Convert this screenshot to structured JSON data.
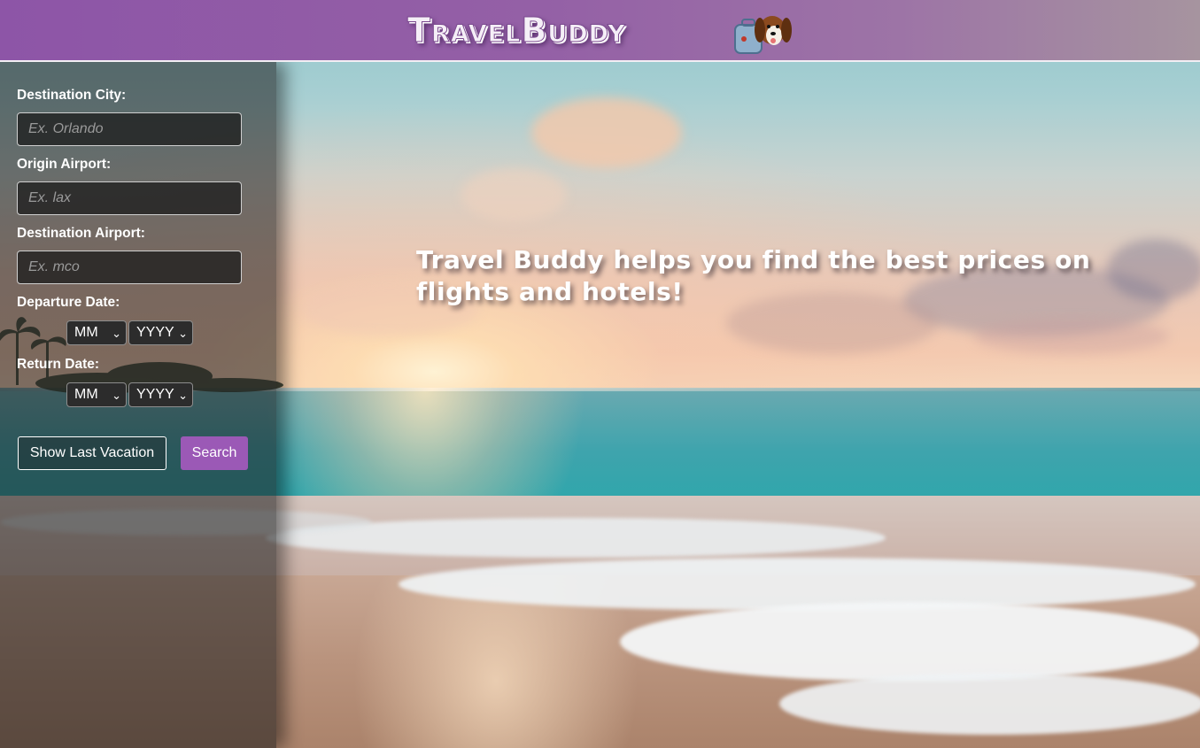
{
  "header": {
    "logo_text": "TravelBuddy",
    "mascot_icon": "dog-with-suitcase-icon"
  },
  "sidebar": {
    "destination_city": {
      "label": "Destination City:",
      "placeholder": "Ex. Orlando",
      "value": ""
    },
    "origin_airport": {
      "label": "Origin Airport:",
      "placeholder": "Ex. lax",
      "value": ""
    },
    "destination_airport": {
      "label": "Destination Airport:",
      "placeholder": "Ex. mco",
      "value": ""
    },
    "departure_date": {
      "label": "Departure Date:",
      "month": "MM",
      "year": "YYYY"
    },
    "return_date": {
      "label": "Return Date:",
      "month": "MM",
      "year": "YYYY"
    },
    "show_last_label": "Show Last Vacation",
    "search_label": "Search"
  },
  "main": {
    "tagline": "Travel Buddy helps you find the best prices on flights and hotels!"
  },
  "colors": {
    "header_purple": "#8d55a7",
    "accent": "#9b59b6"
  }
}
